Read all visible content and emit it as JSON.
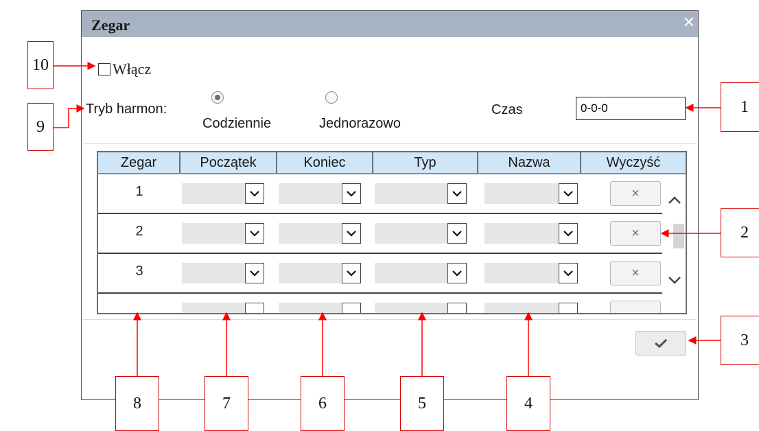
{
  "dialog": {
    "title": "Zegar",
    "close_glyph": "✕",
    "enable_label": "Włącz",
    "schedule_mode_label": "Tryb harmon:",
    "modes": [
      {
        "label": "Codziennie",
        "selected": true
      },
      {
        "label": "Jednorazowo",
        "selected": false
      }
    ],
    "time_label": "Czas",
    "time_value": "0-0-0",
    "grid": {
      "columns": [
        "Zegar",
        "Początek",
        "Koniec",
        "Typ",
        "Nazwa",
        "Wyczyść"
      ],
      "rows": [
        "1",
        "2",
        "3"
      ]
    },
    "icons": {
      "dropdown": "chevron-down-icon",
      "clear": "close-icon",
      "apply": "checkmark-icon",
      "scroll_up": "chevron-up-icon",
      "scroll_down": "chevron-down-icon"
    }
  },
  "callouts": [
    "1",
    "2",
    "3",
    "4",
    "5",
    "6",
    "7",
    "8",
    "9",
    "10"
  ],
  "colors": {
    "titlebar": "#a7b3c3",
    "header": "#cfe6f8",
    "callout_border": "#d40000",
    "callout_arrow": "#ff0000"
  }
}
